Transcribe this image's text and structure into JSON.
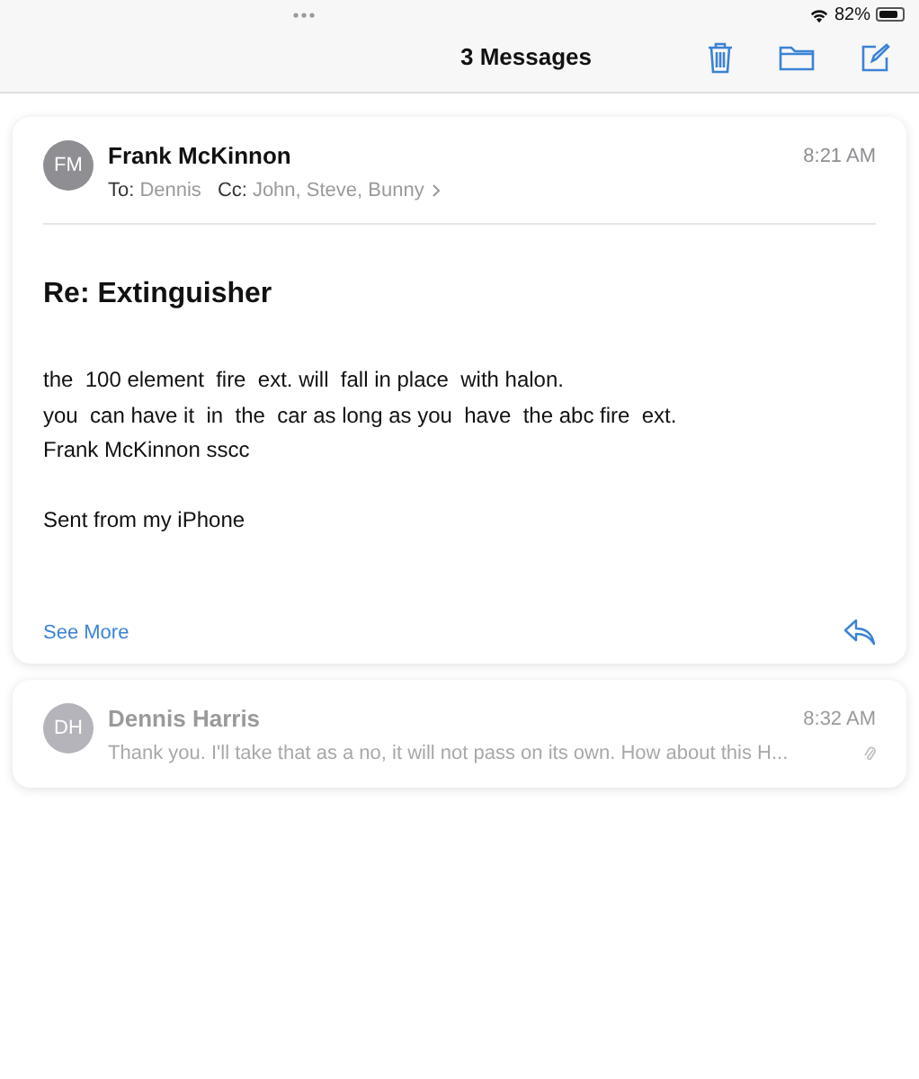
{
  "status_bar": {
    "battery_percent": "82%"
  },
  "toolbar": {
    "title": "3 Messages"
  },
  "messages": [
    {
      "expanded": true,
      "initials": "FM",
      "sender": "Frank McKinnon",
      "time": "8:21 AM",
      "to_label": "To:",
      "to": "Dennis",
      "cc_label": "Cc:",
      "cc": "John, Steve, Bunny",
      "subject": "Re: Extinguisher",
      "body": [
        "the  100 element  fire  ext. will  fall in place  with halon.\nyou  can have it  in  the  car as long as you  have  the abc fire  ext.\nFrank McKinnon sscc",
        "Sent from my iPhone"
      ],
      "see_more": "See More"
    },
    {
      "expanded": false,
      "initials": "DH",
      "sender": "Dennis Harris",
      "time": "8:32 AM",
      "preview": "Thank you. I'll take that as a no, it will not pass on its own. How about this H...",
      "has_attachment": true
    }
  ]
}
